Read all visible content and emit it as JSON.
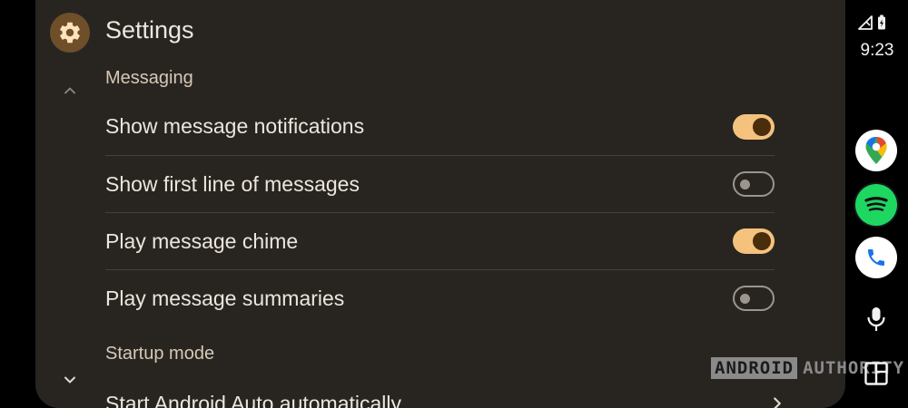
{
  "header": {
    "title": "Settings",
    "icon": "gear-icon"
  },
  "sections": [
    {
      "label": "Messaging"
    },
    {
      "label": "Startup mode"
    }
  ],
  "settings": [
    {
      "label": "Show message notifications",
      "enabled": true
    },
    {
      "label": "Show first line of messages",
      "enabled": false
    },
    {
      "label": "Play message chime",
      "enabled": true
    },
    {
      "label": "Play message summaries",
      "enabled": false
    }
  ],
  "startup_item": {
    "label": "Start Android Auto automatically"
  },
  "status_bar": {
    "time": "9:23"
  },
  "rail_apps": [
    {
      "name": "maps-app",
      "icon": "maps-pin-icon"
    },
    {
      "name": "spotify-app",
      "icon": "spotify-icon"
    },
    {
      "name": "phone-app",
      "icon": "phone-icon"
    }
  ],
  "watermark": {
    "box": "ANDROID",
    "text": "AUTHORITY"
  },
  "colors": {
    "panel": "#282521",
    "accent": "#f4c27d",
    "knob_on": "#4a2d0b",
    "gear_badge": "#6e4f2a",
    "spotify": "#1ed760"
  }
}
